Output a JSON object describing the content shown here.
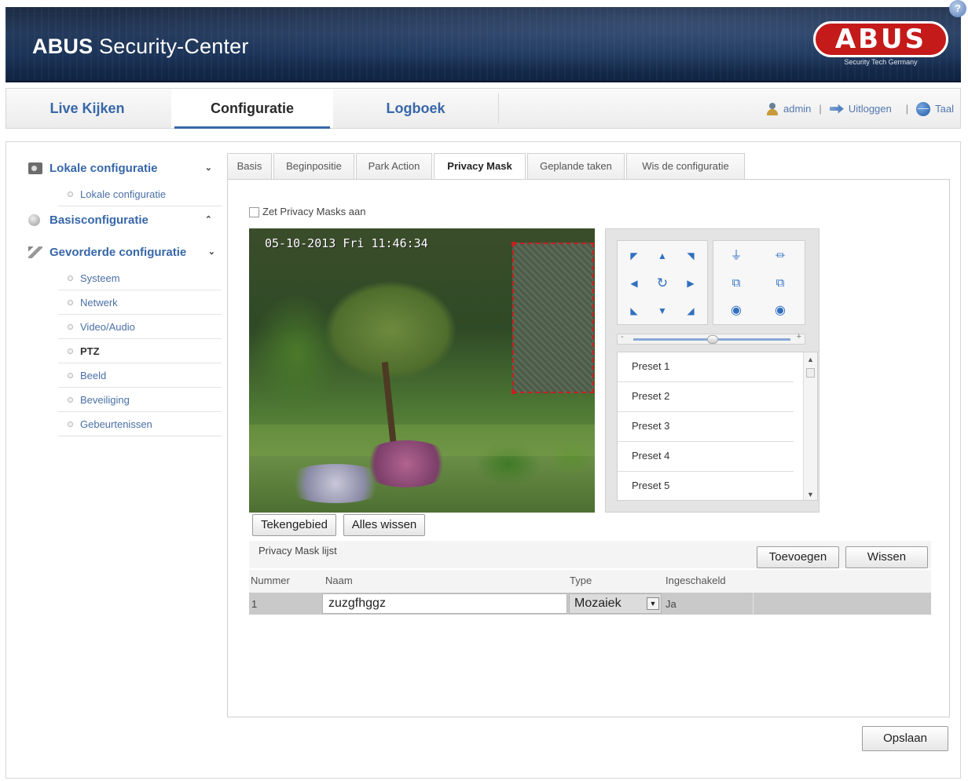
{
  "header": {
    "title_bold": "ABUS",
    "title_rest": " Security-Center",
    "logo_word": "ABUS",
    "logo_tagline": "Security Tech Germany",
    "help_symbol": "?"
  },
  "nav": {
    "tabs": [
      {
        "label": "Live Kijken",
        "active": false
      },
      {
        "label": "Configuratie",
        "active": true
      },
      {
        "label": "Logboek",
        "active": false
      }
    ],
    "user": "admin",
    "logout": "Uitloggen",
    "language": "Taal"
  },
  "sidebar": {
    "local": {
      "label": "Lokale configuratie",
      "chevron": "⌄",
      "items": [
        "Lokale configuratie"
      ]
    },
    "basic": {
      "label": "Basisconfiguratie",
      "chevron": "⌃"
    },
    "advanced": {
      "label": "Gevorderde configuratie",
      "chevron": "⌄",
      "items": [
        "Systeem",
        "Netwerk",
        "Video/Audio",
        "PTZ",
        "Beeld",
        "Beveiliging",
        "Gebeurtenissen"
      ],
      "active_item": "PTZ"
    }
  },
  "tabs": [
    "Basis",
    "Beginpositie",
    "Park Action",
    "Privacy Mask",
    "Geplande taken",
    "Wis de configuratie"
  ],
  "active_tab": "Privacy Mask",
  "privacy": {
    "enable_label": "Zet Privacy Masks aan",
    "enabled": false,
    "osd_text": "05-10-2013 Fri 11:46:34",
    "draw_button": "Tekengebied",
    "clear_all_button": "Alles wissen",
    "list_title": "Privacy Mask lijst",
    "add_button": "Toevoegen",
    "delete_button": "Wissen",
    "columns": {
      "number": "Nummer",
      "name": "Naam",
      "type": "Type",
      "enabled": "Ingeschakeld"
    },
    "rows": [
      {
        "number": "1",
        "name": "zuzgfhggz",
        "type": "Mozaiek",
        "enabled": "Ja"
      }
    ]
  },
  "ptz": {
    "presets": [
      "Preset 1",
      "Preset 2",
      "Preset 3",
      "Preset 4",
      "Preset 5"
    ],
    "speed_minus": "-",
    "speed_plus": "+"
  },
  "save_button": "Opslaan"
}
